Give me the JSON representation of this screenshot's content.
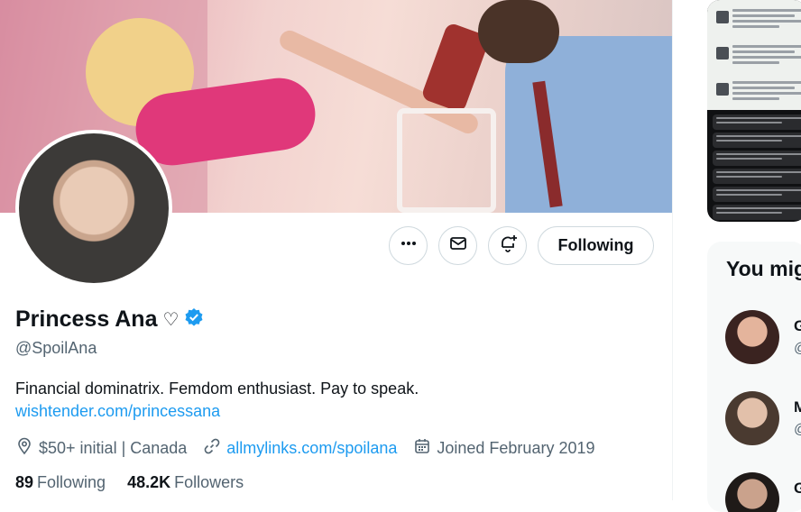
{
  "profile": {
    "display_name": "Princess Ana",
    "heart_symbol": "♡",
    "handle": "@SpoilAna",
    "bio": "Financial dominatrix. Femdom enthusiast. Pay to speak.",
    "bio_link": "wishtender.com/princessana",
    "location": "$50+ initial | Canada",
    "website": "allmylinks.com/spoilana",
    "joined": "Joined February 2019",
    "following_count": "89",
    "following_label": "Following",
    "followers_count": "48.2K",
    "followers_label": "Followers"
  },
  "actions": {
    "following_button": "Following"
  },
  "sidebar": {
    "who_to_follow_title": "You might like",
    "suggestions": [
      {
        "initial": "G",
        "handle_start": "@"
      },
      {
        "initial": "M",
        "handle_start": "@"
      },
      {
        "initial": "G",
        "handle_start": ""
      }
    ]
  },
  "colors": {
    "accent": "#1d9bf0",
    "verified": "#1d9bf0",
    "text_secondary": "#536471"
  },
  "icons": [
    "more-icon",
    "message-icon",
    "notify-icon",
    "location-icon",
    "link-icon",
    "calendar-icon",
    "verified-icon"
  ]
}
